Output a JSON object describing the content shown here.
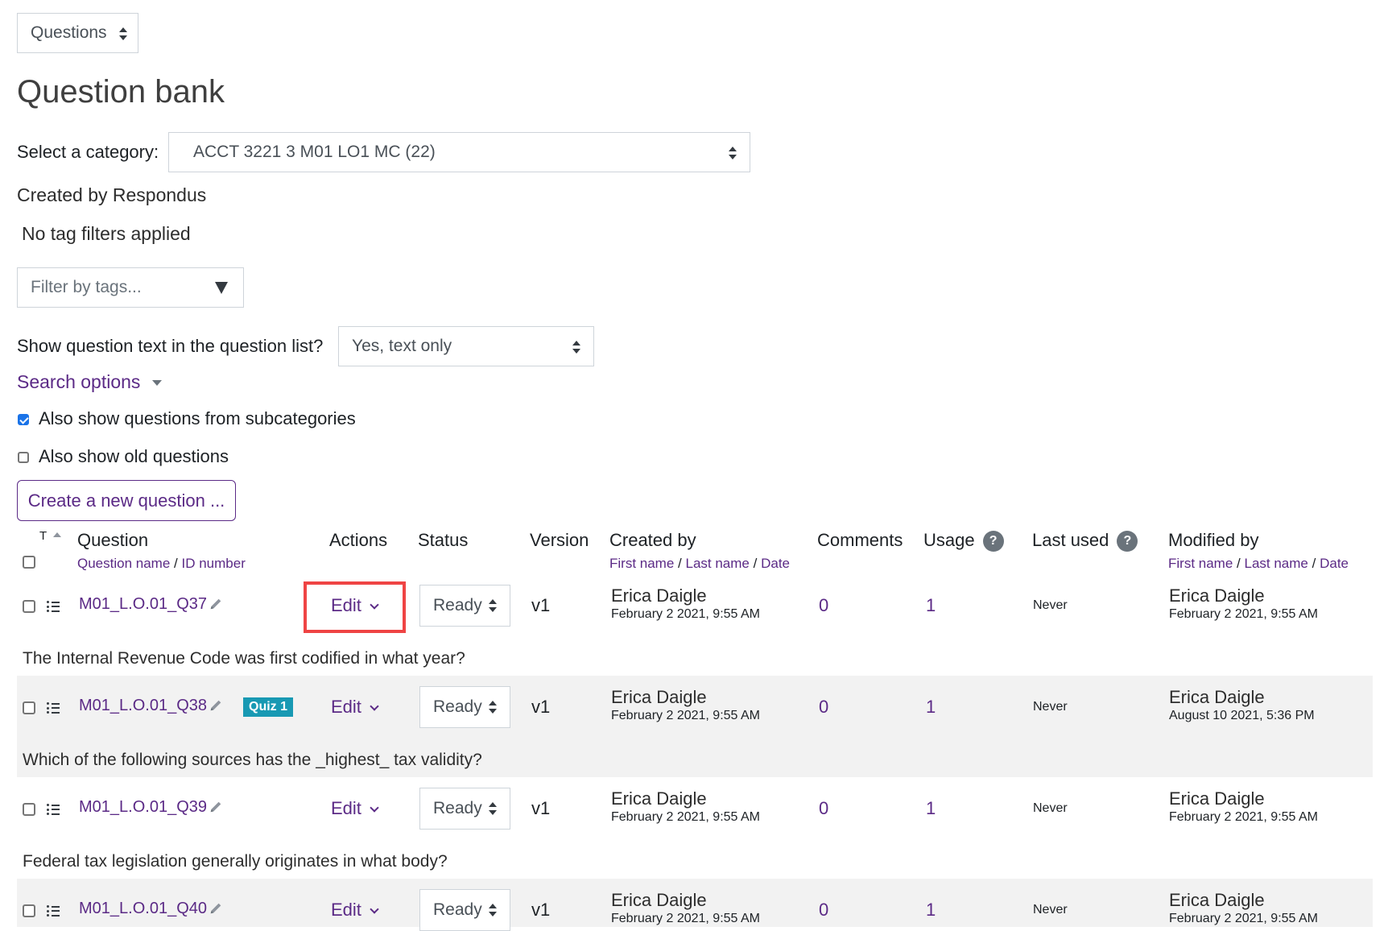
{
  "nav_select": {
    "value": "Questions"
  },
  "page_title": "Question bank",
  "category": {
    "label": "Select a category:",
    "value": "ACCT 3221 3 M01 LO1 MC (22)"
  },
  "category_info": "Created by Respondus",
  "tag_status": "No tag filters applied",
  "tag_filter": {
    "placeholder": "Filter by tags..."
  },
  "show_text": {
    "label": "Show question text in the question list?",
    "value": "Yes, text only"
  },
  "search_options": "Search options",
  "options": {
    "subcategories": {
      "label": "Also show questions from subcategories",
      "checked": true
    },
    "old_questions": {
      "label": "Also show old questions",
      "checked": false
    }
  },
  "create_button": "Create a new question ...",
  "table": {
    "headers": {
      "type": "T",
      "question": "Question",
      "question_sub": [
        "Question name",
        "ID number"
      ],
      "actions": "Actions",
      "status": "Status",
      "version": "Version",
      "created_by": "Created by",
      "created_sub": [
        "First name",
        "Last name",
        "Date"
      ],
      "comments": "Comments",
      "usage": "Usage",
      "last_used": "Last used",
      "modified_by": "Modified by",
      "modified_sub": [
        "First name",
        "Last name",
        "Date"
      ],
      "help_glyph": "?",
      "separator": "/"
    },
    "rows": [
      {
        "name": "M01_L.O.01_Q37",
        "badge": null,
        "action": "Edit",
        "status": "Ready",
        "version": "v1",
        "created_name": "Erica Daigle",
        "created_date": "February 2 2021, 9:55 AM",
        "comments": "0",
        "usage": "1",
        "last_used": "Never",
        "modified_name": "Erica Daigle",
        "modified_date": "February 2 2021, 9:55 AM",
        "text": "The Internal Revenue Code was first codified in what year?"
      },
      {
        "name": "M01_L.O.01_Q38",
        "badge": "Quiz 1",
        "action": "Edit",
        "status": "Ready",
        "version": "v1",
        "created_name": "Erica Daigle",
        "created_date": "February 2 2021, 9:55 AM",
        "comments": "0",
        "usage": "1",
        "last_used": "Never",
        "modified_name": "Erica Daigle",
        "modified_date": "August 10 2021, 5:36 PM",
        "text": "Which of the following sources has the _highest_ tax validity?"
      },
      {
        "name": "M01_L.O.01_Q39",
        "badge": null,
        "action": "Edit",
        "status": "Ready",
        "version": "v1",
        "created_name": "Erica Daigle",
        "created_date": "February 2 2021, 9:55 AM",
        "comments": "0",
        "usage": "1",
        "last_used": "Never",
        "modified_name": "Erica Daigle",
        "modified_date": "February 2 2021, 9:55 AM",
        "text": "Federal tax legislation generally originates in what body?"
      },
      {
        "name": "M01_L.O.01_Q40",
        "badge": null,
        "action": "Edit",
        "status": "Ready",
        "version": "v1",
        "created_name": "Erica Daigle",
        "created_date": "February 2 2021, 9:55 AM",
        "comments": "0",
        "usage": "1",
        "last_used": "Never",
        "modified_name": "Erica Daigle",
        "modified_date": "February 2 2021, 9:55 AM",
        "text": ""
      }
    ]
  },
  "highlight": {
    "row": 0,
    "target": "Edit",
    "color": "#ef4444"
  },
  "colors": {
    "link": "#5b2a86",
    "badge": "#1899b3",
    "checkbox": "#1a73e8",
    "row_alt": "#f2f2f2"
  }
}
